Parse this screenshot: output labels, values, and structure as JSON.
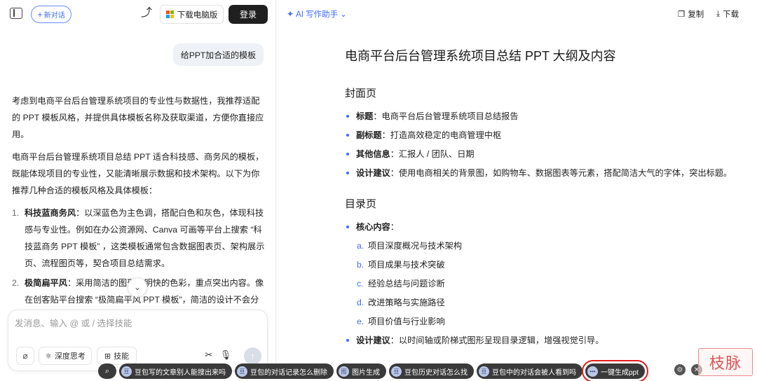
{
  "topbar": {
    "new_chat_label": "新对话",
    "download_label": "下载电脑版",
    "login_label": "登录"
  },
  "chat": {
    "user_message": "给PPT加合适的模板",
    "answer_p1": "考虑到电商平台后台管理系统项目的专业性与数据性，我推荐适配的 PPT 模板风格，并提供具体模板名称及获取渠道，方便你直接应用。",
    "answer_p2": "电商平台后台管理系统项目总结 PPT 适合科技感、商务风的模板，既能体现项目的专业性，又能清晰展示数据和技术架构。以下为你推荐几种合适的模板风格及具体模板：",
    "items": [
      {
        "num": "1.",
        "title": "科技蓝商务风",
        "text": "：以深蓝色为主色调，搭配白色和灰色，体现科技感与专业性。例如在办公资源网、Canva 可画等平台上搜索 “科技蓝商务 PPT 模板” ，这类模板通常包含数据图表页、架构展示页、流程图页等，契合项目总结需求。"
      },
      {
        "num": "2.",
        "title": "极简扁平风",
        "text": "：采用简洁的图形和明快的色彩，重点突出内容。像在创客贴平台搜索 “极简扁平风 PPT 模板”，简洁的设计不会分散观众对项目成果、数据的注意力，让关键信息一目了然。"
      }
    ]
  },
  "composer": {
    "placeholder": "发消息、输入 @ 或 / 选择技能",
    "think_label": "深度思考",
    "skill_label": "技能"
  },
  "doc_toolbar": {
    "ai_label": "AI 写作助手",
    "copy_label": "复制",
    "download_label": "下载"
  },
  "doc": {
    "title": "电商平台后台管理系统项目总结 PPT 大纲及内容",
    "cover": {
      "heading": "封面页",
      "items": [
        {
          "label": "标题",
          "text": "：电商平台后台管理系统项目总结报告"
        },
        {
          "label": "副标题",
          "text": "：打造高效稳定的电商管理中枢"
        },
        {
          "label": "其他信息",
          "text": "：汇报人 / 团队、日期"
        },
        {
          "label": "设计建议",
          "text": "：使用电商相关的背景图，如购物车、数据图表等元素，搭配简洁大气的字体，突出标题。"
        }
      ]
    },
    "toc": {
      "heading": "目录页",
      "core_label": "核心内容",
      "core_suffix": "：",
      "sub_items": [
        {
          "letter": "a.",
          "text": "项目深度概况与技术架构"
        },
        {
          "letter": "b.",
          "text": "项目成果与技术突破"
        },
        {
          "letter": "c.",
          "text": "经验总结与问题诊断"
        },
        {
          "letter": "d.",
          "text": "改进策略与实施路径"
        },
        {
          "letter": "e.",
          "text": "项目价值与行业影响"
        }
      ],
      "design_label": "设计建议",
      "design_text": "：以时间轴或阶梯式图形呈现目录逻辑，增强视觉引导。"
    }
  },
  "suggestions": [
    {
      "av": "豆",
      "text": "豆包写的文章别人能搜出来吗"
    },
    {
      "av": "豆",
      "text": "豆包的对话记录怎么删除"
    },
    {
      "av": "图",
      "text": "图片生成"
    },
    {
      "av": "豆",
      "text": "豆包历史对话怎么找"
    },
    {
      "av": "豆",
      "text": "豆包中的对话会被人看到吗"
    }
  ],
  "ppt_button": {
    "text": "一键生成ppt"
  },
  "watermark": {
    "text": "枝脉"
  },
  "colors": {
    "accent": "#3d6cf5",
    "highlight": "#e21d1d"
  }
}
